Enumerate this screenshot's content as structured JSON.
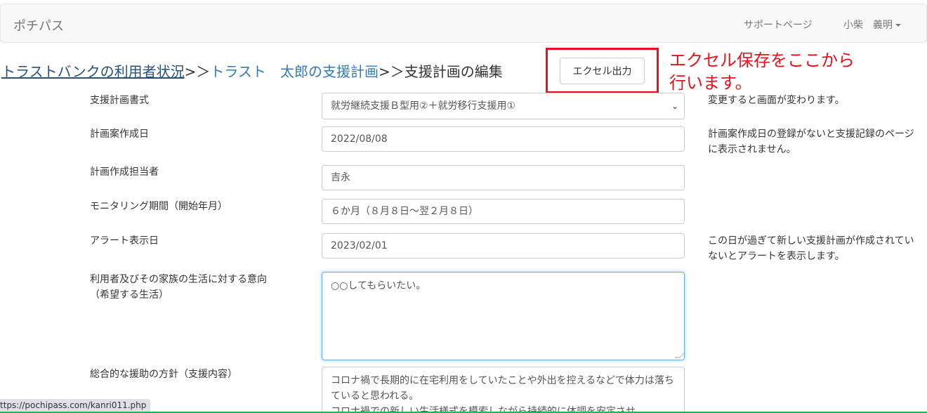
{
  "navbar": {
    "brand": "ポチパス",
    "support_link": "サポートページ",
    "user_menu": "小柴　義明"
  },
  "breadcrumb": {
    "items": [
      "トラストバンクの利用者状況",
      "トラスト　太郎の支援計画"
    ],
    "separator": ">＞",
    "current": "支援計画の編集"
  },
  "toolbar": {
    "excel_button": "エクセル出力"
  },
  "annotation": {
    "line1": "エクセル保存をここから",
    "line2": "行います。",
    "color": "#e8121b"
  },
  "form": {
    "plan_format": {
      "label": "支援計画書式",
      "value": "就労継続支援Ｂ型用②＋就労移行支援用①",
      "help": "変更すると画面が変わります。"
    },
    "draft_date": {
      "label": "計画案作成日",
      "value": "2022/08/08",
      "help": "計画案作成日の登録がないと支援記録のページに表示されません。"
    },
    "staff": {
      "label": "計画作成担当者",
      "value": "吉永"
    },
    "monitoring": {
      "label": "モニタリング期間（開始年月）",
      "value": "６か月（８月８日～翌２月８日）"
    },
    "alert_date": {
      "label": "アラート表示日",
      "value": "2023/02/01",
      "help": "この日が過ぎて新しい支援計画が作成されていないとアラートを表示します。"
    },
    "intention": {
      "label_line1": "利用者及びその家族の生活に対する意向",
      "label_line2": "（希望する生活）",
      "value": "○○してもらいたい。"
    },
    "policy": {
      "label": "総合的な援助の方針（支援内容）",
      "value": "コロナ禍で長期的に在宅利用をしていたことや外出を控えるなどで体力は落ちていると思われる。\nコロナ禍での新しい生活様式を模索しながら持続的に体調を安定させ"
    }
  },
  "status_url": "ttps://pochipass.com/kanri011.php"
}
